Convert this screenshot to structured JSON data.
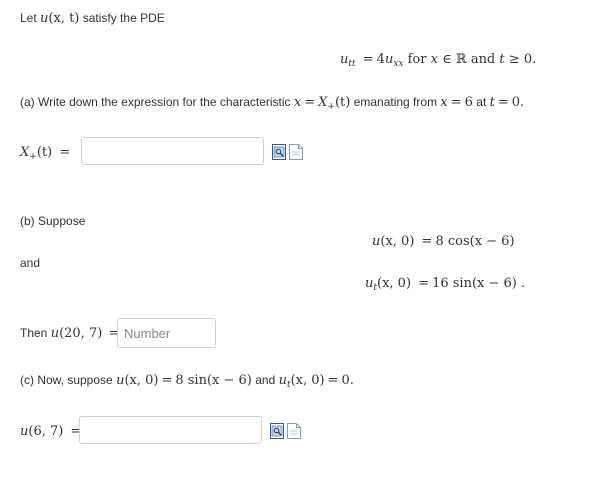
{
  "intro": {
    "text_before": "Let",
    "u": "u",
    "args": "(x, t)",
    "text_after": "satisfy the PDE"
  },
  "pde": {
    "lhs_var": "u",
    "lhs_sub": "tt",
    "equals": "=",
    "coef": "4",
    "rhs_var": "u",
    "rhs_sub": "xx",
    "for_word": "for",
    "x": "x",
    "in_sym": "∈",
    "reals": "ℝ",
    "and_word": "and",
    "t": "t",
    "geq": "≥",
    "zero": "0."
  },
  "part_a": {
    "prompt_start": "(a) Write down the expression for the characteristic",
    "char_x": "x",
    "equals": "=",
    "char_X": "X",
    "char_plus": "+",
    "char_t": "(t)",
    "prompt_mid": "emanating from",
    "from_x": "x",
    "from_equals": "=",
    "from_val": "6",
    "prompt_at": "at",
    "at_t": "t",
    "at_equals": "=",
    "at_val": "0.",
    "label_X": "X",
    "label_plus": "+",
    "label_args": "(t)",
    "label_equals": "="
  },
  "part_b": {
    "suppose": "(b) Suppose",
    "ic1_u": "u",
    "ic1_args": "(x, 0)",
    "ic1_equals": "=",
    "ic1_rhs": "8 cos(x − 6)",
    "and_word": "and",
    "ic2_u": "u",
    "ic2_sub": "t",
    "ic2_args": "(x, 0)",
    "ic2_equals": "=",
    "ic2_rhs": "16 sin(x − 6) .",
    "then_word": "Then",
    "then_u": "u",
    "then_args": "(20, 7)",
    "then_equals": "=",
    "number_placeholder": "Number"
  },
  "part_c": {
    "prompt_start": "(c) Now, suppose",
    "ic1_u": "u",
    "ic1_args": "(x, 0)",
    "ic1_equals": "=",
    "ic1_rhs": "8 sin(x − 6)",
    "and_word": "and",
    "ic2_u": "u",
    "ic2_sub": "t",
    "ic2_args": "(x, 0)",
    "ic2_equals": "=",
    "ic2_rhs": "0.",
    "label_u": "u",
    "label_args": "(6, 7)",
    "label_equals": "="
  },
  "icons": {
    "preview": "equation-preview-icon",
    "editor": "equation-editor-icon"
  },
  "colors": {
    "text": "#333333",
    "box_border": "#cfcfcf",
    "icon_blue": "#2f5f9a"
  }
}
